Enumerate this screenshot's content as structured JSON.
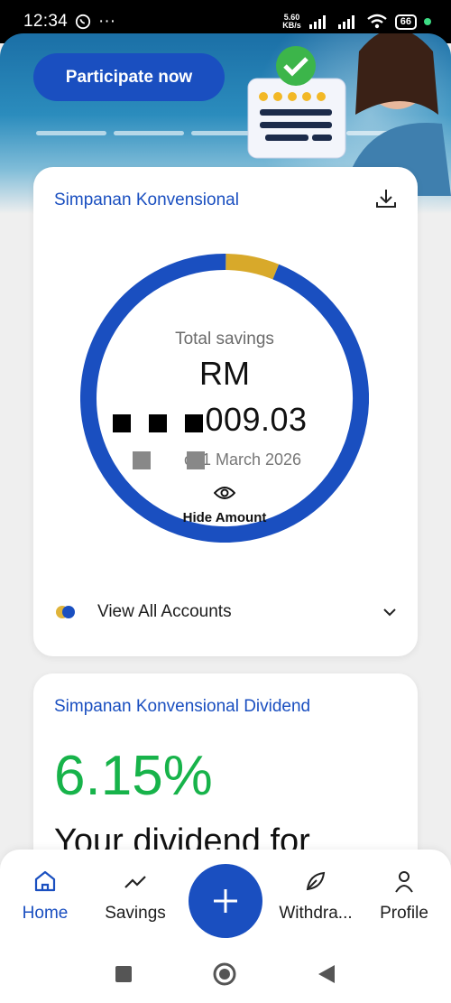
{
  "status_bar": {
    "time": "12:34",
    "network_speed": "5.60",
    "network_unit": "KB/s",
    "battery": "66"
  },
  "banner": {
    "cta_label": "Participate now"
  },
  "savings_card": {
    "title": "Simpanan Konvensional",
    "total_label": "Total savings",
    "currency": "RM",
    "amount_visible": "009.03",
    "as_of": "of 1 March 2026",
    "hide_label": "Hide Amount",
    "view_all_label": "View All Accounts",
    "donut": {
      "segments": [
        {
          "name": "primary",
          "fraction": 0.94,
          "color": "#1a4fc0"
        },
        {
          "name": "secondary",
          "fraction": 0.06,
          "color": "#d8a92a"
        }
      ]
    }
  },
  "dividend_card": {
    "title": "Simpanan Konvensional Dividend",
    "rate": "6.15%",
    "text": "Your dividend for"
  },
  "bottom_nav": {
    "items": [
      {
        "label": "Home",
        "icon": "home-icon",
        "active": true
      },
      {
        "label": "Savings",
        "icon": "trend-icon",
        "active": false
      },
      {
        "label": "Withdra...",
        "icon": "leaf-icon",
        "active": false
      },
      {
        "label": "Profile",
        "icon": "person-icon",
        "active": false
      }
    ]
  },
  "colors": {
    "brand_blue": "#1a4fc0",
    "accent_gold": "#d8a92a",
    "success_green": "#17b34a"
  }
}
